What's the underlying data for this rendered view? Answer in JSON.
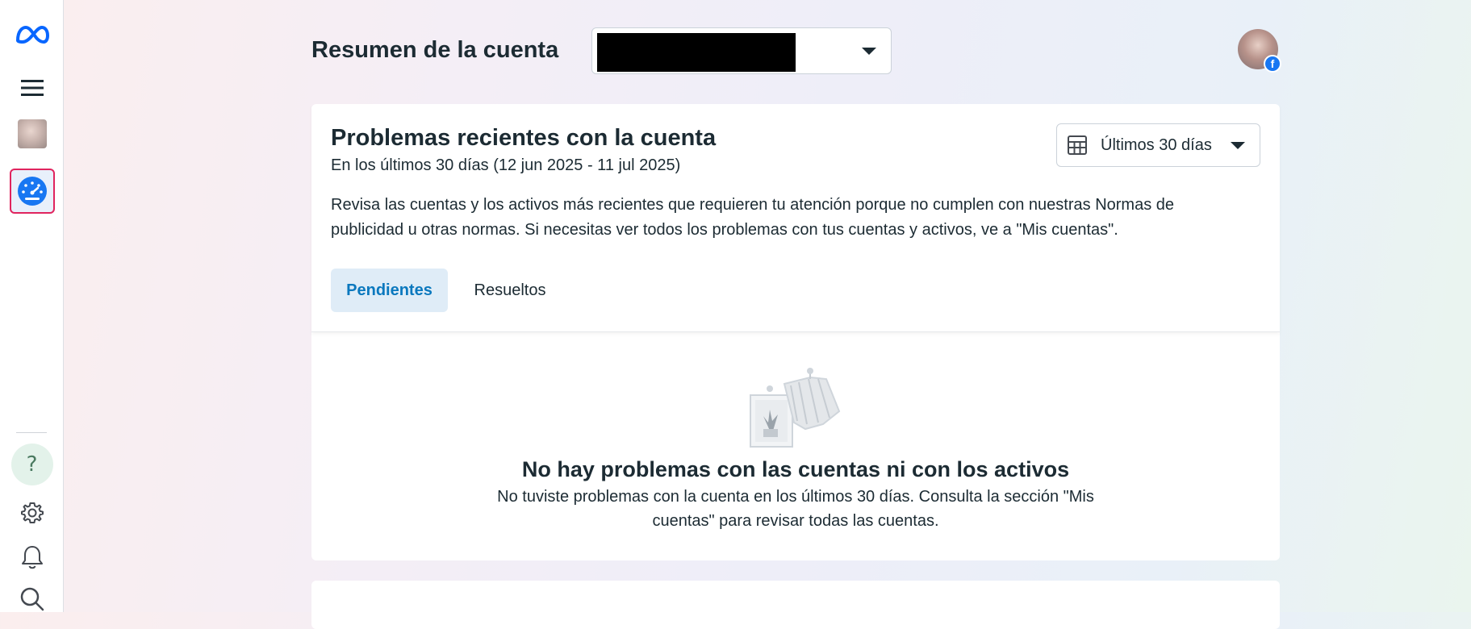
{
  "header": {
    "title": "Resumen de la cuenta",
    "account_select_value": ""
  },
  "sidebar": {
    "items": [
      {
        "name": "meta-logo",
        "icon": "meta-logo-icon"
      },
      {
        "name": "menu",
        "icon": "hamburger-icon"
      },
      {
        "name": "account-thumbnail",
        "icon": "image-thumbnail"
      },
      {
        "name": "account-overview",
        "icon": "speedometer-icon",
        "selected": true
      },
      {
        "name": "help",
        "icon": "question-icon",
        "glyph": "?"
      },
      {
        "name": "settings",
        "icon": "gear-icon"
      },
      {
        "name": "notifications",
        "icon": "bell-icon"
      },
      {
        "name": "search",
        "icon": "search-icon"
      }
    ]
  },
  "card": {
    "title": "Problemas recientes con la cuenta",
    "subtitle": "En los últimos 30 días (12 jun 2025 - 11 jul 2025)",
    "description": "Revisa las cuentas y los activos más recientes que requieren tu atención porque no cumplen con nuestras Normas de publicidad u otras normas. Si necesitas ver todos los problemas con tus cuentas y activos, ve a \"Mis cuentas\".",
    "date_range_label": "Últimos 30 días",
    "tabs": [
      {
        "label": "Pendientes",
        "active": true
      },
      {
        "label": "Resueltos",
        "active": false
      }
    ],
    "empty_state": {
      "title": "No hay problemas con las cuentas ni con los activos",
      "text": "No tuviste problemas con la cuenta en los últimos 30 días. Consulta la sección \"Mis cuentas\" para revisar todas las cuentas."
    }
  },
  "colors": {
    "accent": "#0a78be",
    "selected_border": "#e0245e",
    "facebook_blue": "#1877f2"
  }
}
